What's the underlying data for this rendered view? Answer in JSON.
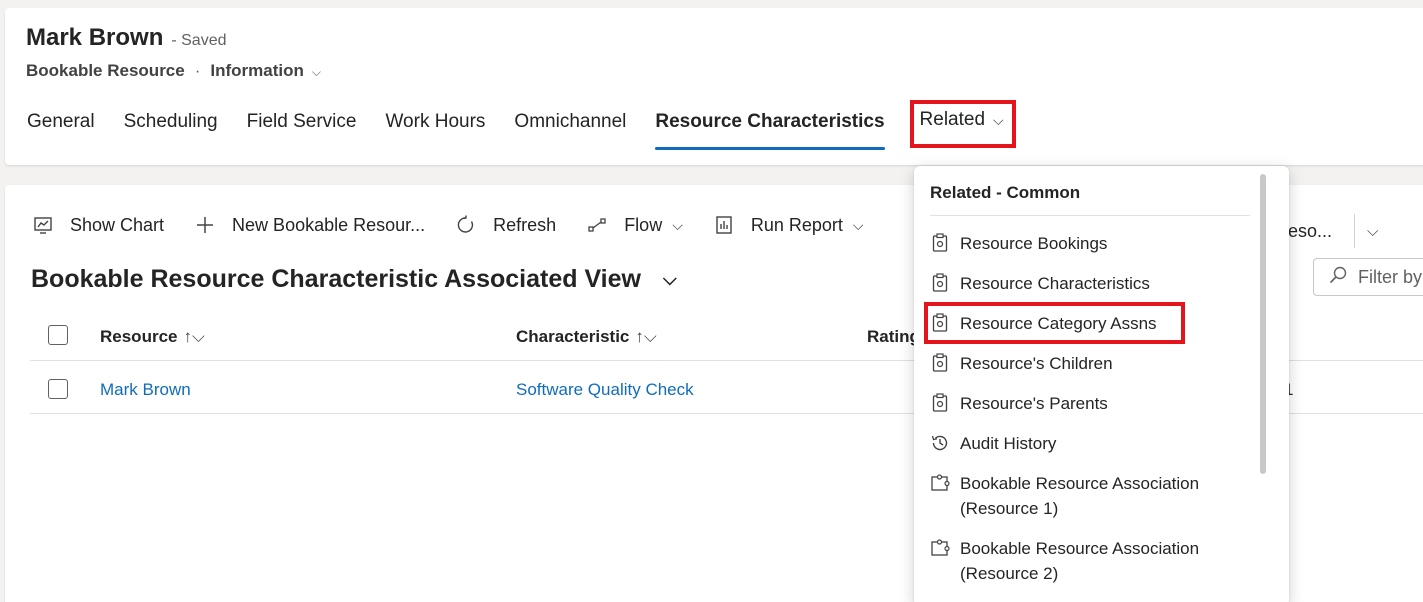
{
  "header": {
    "record_name": "Mark Brown",
    "saved_status": "- Saved",
    "entity": "Bookable Resource",
    "separator": "·",
    "form": "Information"
  },
  "tabs": [
    {
      "label": "General"
    },
    {
      "label": "Scheduling"
    },
    {
      "label": "Field Service"
    },
    {
      "label": "Work Hours"
    },
    {
      "label": "Omnichannel"
    },
    {
      "label": "Resource Characteristics",
      "active": true
    },
    {
      "label": "Related"
    }
  ],
  "toolbar": {
    "show_chart": "Show Chart",
    "new_record": "New Bookable Resour...",
    "refresh": "Refresh",
    "flow": "Flow",
    "run_report": "Run Report",
    "truncated_right": "eso..."
  },
  "view": {
    "title": "Bookable Resource Characteristic Associated View",
    "filter_placeholder": "Filter by"
  },
  "grid": {
    "columns": [
      "Resource",
      "Characteristic",
      "Rating"
    ],
    "rows": [
      {
        "resource": "Mark Brown",
        "characteristic": "Software Quality Check",
        "partial_cell": "1"
      }
    ]
  },
  "related_menu": {
    "header": "Related - Common",
    "items": [
      {
        "label": "Resource Bookings",
        "icon": "entity-icon"
      },
      {
        "label": "Resource Characteristics",
        "icon": "entity-icon"
      },
      {
        "label": "Resource Category Assns",
        "icon": "entity-icon",
        "highlighted": true
      },
      {
        "label": "Resource's Children",
        "icon": "entity-icon"
      },
      {
        "label": "Resource's Parents",
        "icon": "entity-icon"
      },
      {
        "label": "Audit History",
        "icon": "history-icon"
      },
      {
        "label": "Bookable Resource Association",
        "label2": "(Resource 1)",
        "icon": "puzzle-icon"
      },
      {
        "label": "Bookable Resource Association",
        "label2": "(Resource 2)",
        "icon": "puzzle-icon"
      }
    ]
  },
  "colors": {
    "accent": "#0f6cbd",
    "highlight_border": "#e3141b"
  }
}
